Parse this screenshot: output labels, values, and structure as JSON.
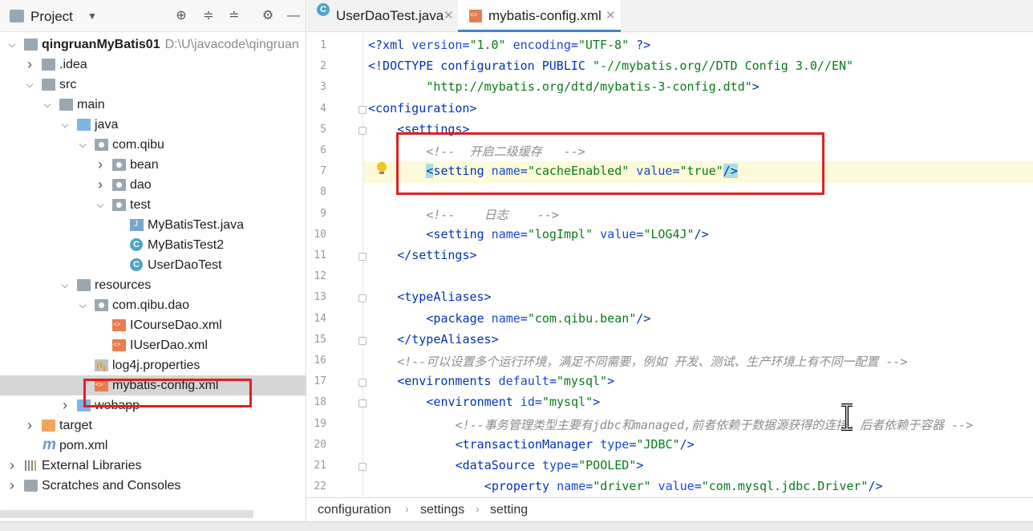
{
  "project_panel": {
    "title": "Project",
    "tree": [
      {
        "label": "qingruanMyBatis01",
        "path": "D:\\U\\javacode\\qingruan",
        "depth": 0,
        "arrow": "open",
        "icon": "module-folder-icon",
        "bold": true
      },
      {
        "label": ".idea",
        "depth": 1,
        "arrow": "closed",
        "icon": "folder-icon"
      },
      {
        "label": "src",
        "depth": 1,
        "arrow": "open",
        "icon": "folder-icon"
      },
      {
        "label": "main",
        "depth": 2,
        "arrow": "open",
        "icon": "folder-icon"
      },
      {
        "label": "java",
        "depth": 3,
        "arrow": "open",
        "icon": "source-folder-icon"
      },
      {
        "label": "com.qibu",
        "depth": 4,
        "arrow": "open",
        "icon": "package-icon"
      },
      {
        "label": "bean",
        "depth": 5,
        "arrow": "closed",
        "icon": "package-icon"
      },
      {
        "label": "dao",
        "depth": 5,
        "arrow": "closed",
        "icon": "package-icon"
      },
      {
        "label": "test",
        "depth": 5,
        "arrow": "open",
        "icon": "package-icon"
      },
      {
        "label": "MyBatisTest.java",
        "depth": 6,
        "arrow": "none",
        "icon": "java-file-icon"
      },
      {
        "label": "MyBatisTest2",
        "depth": 6,
        "arrow": "none",
        "icon": "class-icon"
      },
      {
        "label": "UserDaoTest",
        "depth": 6,
        "arrow": "none",
        "icon": "class-icon"
      },
      {
        "label": "resources",
        "depth": 3,
        "arrow": "open",
        "icon": "resources-folder-icon"
      },
      {
        "label": "com.qibu.dao",
        "depth": 4,
        "arrow": "open",
        "icon": "package-icon"
      },
      {
        "label": "ICourseDao.xml",
        "depth": 5,
        "arrow": "none",
        "icon": "xml-file-icon"
      },
      {
        "label": "IUserDao.xml",
        "depth": 5,
        "arrow": "none",
        "icon": "xml-file-icon"
      },
      {
        "label": "log4j.properties",
        "depth": 4,
        "arrow": "none",
        "icon": "properties-file-icon"
      },
      {
        "label": "mybatis-config.xml",
        "depth": 4,
        "arrow": "none",
        "icon": "xml-file-icon",
        "selected": true
      },
      {
        "label": "webapp",
        "depth": 3,
        "arrow": "closed",
        "icon": "web-folder-icon"
      },
      {
        "label": "target",
        "depth": 1,
        "arrow": "closed",
        "icon": "excluded-folder-icon"
      },
      {
        "label": "pom.xml",
        "depth": 1,
        "arrow": "none",
        "icon": "maven-icon"
      },
      {
        "label": "External Libraries",
        "depth": 0,
        "arrow": "closed",
        "icon": "libraries-icon"
      },
      {
        "label": "Scratches and Consoles",
        "depth": 0,
        "arrow": "closed",
        "icon": "scratches-icon"
      }
    ]
  },
  "tabs": [
    {
      "label": "UserDaoTest.java",
      "active": false,
      "icon": "class-icon"
    },
    {
      "label": "mybatis-config.xml",
      "active": true,
      "icon": "xml-file-icon"
    }
  ],
  "editor": {
    "lines": [
      {
        "n": "1",
        "indent": 0,
        "parts": [
          [
            "tg",
            "<?xml "
          ],
          [
            "at",
            "version"
          ],
          [
            "tg",
            "="
          ],
          [
            "av",
            "\"1.0\""
          ],
          [
            "tg",
            " "
          ],
          [
            "at",
            "encoding"
          ],
          [
            "tg",
            "="
          ],
          [
            "av",
            "\"UTF-8\""
          ],
          [
            "tg",
            " ?>"
          ]
        ]
      },
      {
        "n": "2",
        "indent": 0,
        "parts": [
          [
            "tg",
            "<!DOCTYPE configuration PUBLIC "
          ],
          [
            "av",
            "\"-//mybatis.org//DTD Config 3.0//EN\""
          ]
        ]
      },
      {
        "n": "3",
        "indent": 8,
        "parts": [
          [
            "av",
            "\"http://mybatis.org/dtd/mybatis-3-config.dtd\""
          ],
          [
            "tg",
            ">"
          ]
        ]
      },
      {
        "n": "4",
        "indent": 0,
        "parts": [
          [
            "tg",
            "<configuration>"
          ]
        ]
      },
      {
        "n": "5",
        "indent": 4,
        "parts": [
          [
            "tg",
            "<settings>"
          ]
        ]
      },
      {
        "n": "6",
        "indent": 8,
        "parts": [
          [
            "cm",
            "<!--  开启二级缓存   -->"
          ]
        ]
      },
      {
        "n": "7",
        "indent": 8,
        "parts": [
          [
            "hl",
            "<"
          ],
          [
            "tg",
            "setting "
          ],
          [
            "at",
            "name"
          ],
          [
            "tg",
            "="
          ],
          [
            "av",
            "\"cacheEnabled\""
          ],
          [
            "tg",
            " "
          ],
          [
            "at",
            "value"
          ],
          [
            "tg",
            "="
          ],
          [
            "av",
            "\"true\""
          ],
          [
            "hl",
            "/>"
          ]
        ]
      },
      {
        "n": "8",
        "indent": 0,
        "parts": []
      },
      {
        "n": "9",
        "indent": 8,
        "parts": [
          [
            "cm",
            "<!--    日志    -->"
          ]
        ]
      },
      {
        "n": "10",
        "indent": 8,
        "parts": [
          [
            "tg",
            "<setting "
          ],
          [
            "at",
            "name"
          ],
          [
            "tg",
            "="
          ],
          [
            "av",
            "\"logImpl\""
          ],
          [
            "tg",
            " "
          ],
          [
            "at",
            "value"
          ],
          [
            "tg",
            "="
          ],
          [
            "av",
            "\"LOG4J\""
          ],
          [
            "tg",
            "/>"
          ]
        ]
      },
      {
        "n": "11",
        "indent": 4,
        "parts": [
          [
            "tg",
            "</settings>"
          ]
        ]
      },
      {
        "n": "12",
        "indent": 0,
        "parts": []
      },
      {
        "n": "13",
        "indent": 4,
        "parts": [
          [
            "tg",
            "<typeAliases>"
          ]
        ]
      },
      {
        "n": "14",
        "indent": 8,
        "parts": [
          [
            "tg",
            "<package "
          ],
          [
            "at",
            "name"
          ],
          [
            "tg",
            "="
          ],
          [
            "av",
            "\"com.qibu.bean\""
          ],
          [
            "tg",
            "/>"
          ]
        ]
      },
      {
        "n": "15",
        "indent": 4,
        "parts": [
          [
            "tg",
            "</typeAliases>"
          ]
        ]
      },
      {
        "n": "16",
        "indent": 4,
        "parts": [
          [
            "cm",
            "<!--可以设置多个运行环境，满足不同需要，例如 开发、测试、生产环境上有不同一配置 -->"
          ]
        ]
      },
      {
        "n": "17",
        "indent": 4,
        "parts": [
          [
            "tg",
            "<environments "
          ],
          [
            "at",
            "default"
          ],
          [
            "tg",
            "="
          ],
          [
            "av",
            "\"mysql\""
          ],
          [
            "tg",
            ">"
          ]
        ]
      },
      {
        "n": "18",
        "indent": 8,
        "parts": [
          [
            "tg",
            "<environment "
          ],
          [
            "at",
            "id"
          ],
          [
            "tg",
            "="
          ],
          [
            "av",
            "\"mysql\""
          ],
          [
            "tg",
            ">"
          ]
        ]
      },
      {
        "n": "19",
        "indent": 12,
        "parts": [
          [
            "cm",
            "<!--事务管理类型主要有jdbc和managed,前者依赖于数据源获得的连接，后者依赖于容器 -->"
          ]
        ]
      },
      {
        "n": "20",
        "indent": 12,
        "parts": [
          [
            "tg",
            "<transactionManager "
          ],
          [
            "at",
            "type"
          ],
          [
            "tg",
            "="
          ],
          [
            "av",
            "\"JDBC\""
          ],
          [
            "tg",
            "/>"
          ]
        ]
      },
      {
        "n": "21",
        "indent": 12,
        "parts": [
          [
            "tg",
            "<dataSource "
          ],
          [
            "at",
            "type"
          ],
          [
            "tg",
            "="
          ],
          [
            "av",
            "\"POOLED\""
          ],
          [
            "tg",
            ">"
          ]
        ]
      },
      {
        "n": "22",
        "indent": 16,
        "parts": [
          [
            "tg",
            "<property "
          ],
          [
            "at",
            "name"
          ],
          [
            "tg",
            "="
          ],
          [
            "av",
            "\"driver\""
          ],
          [
            "tg",
            " "
          ],
          [
            "at",
            "value"
          ],
          [
            "tg",
            "="
          ],
          [
            "av",
            "\"com.mysql.jdbc.Driver\""
          ],
          [
            "tg",
            "/>"
          ]
        ]
      }
    ]
  },
  "breadcrumb": [
    "configuration",
    "settings",
    "setting"
  ],
  "colors": {
    "accent": "#4083c9",
    "highlight_box": "#e02020",
    "current_line": "#fcfad9"
  }
}
